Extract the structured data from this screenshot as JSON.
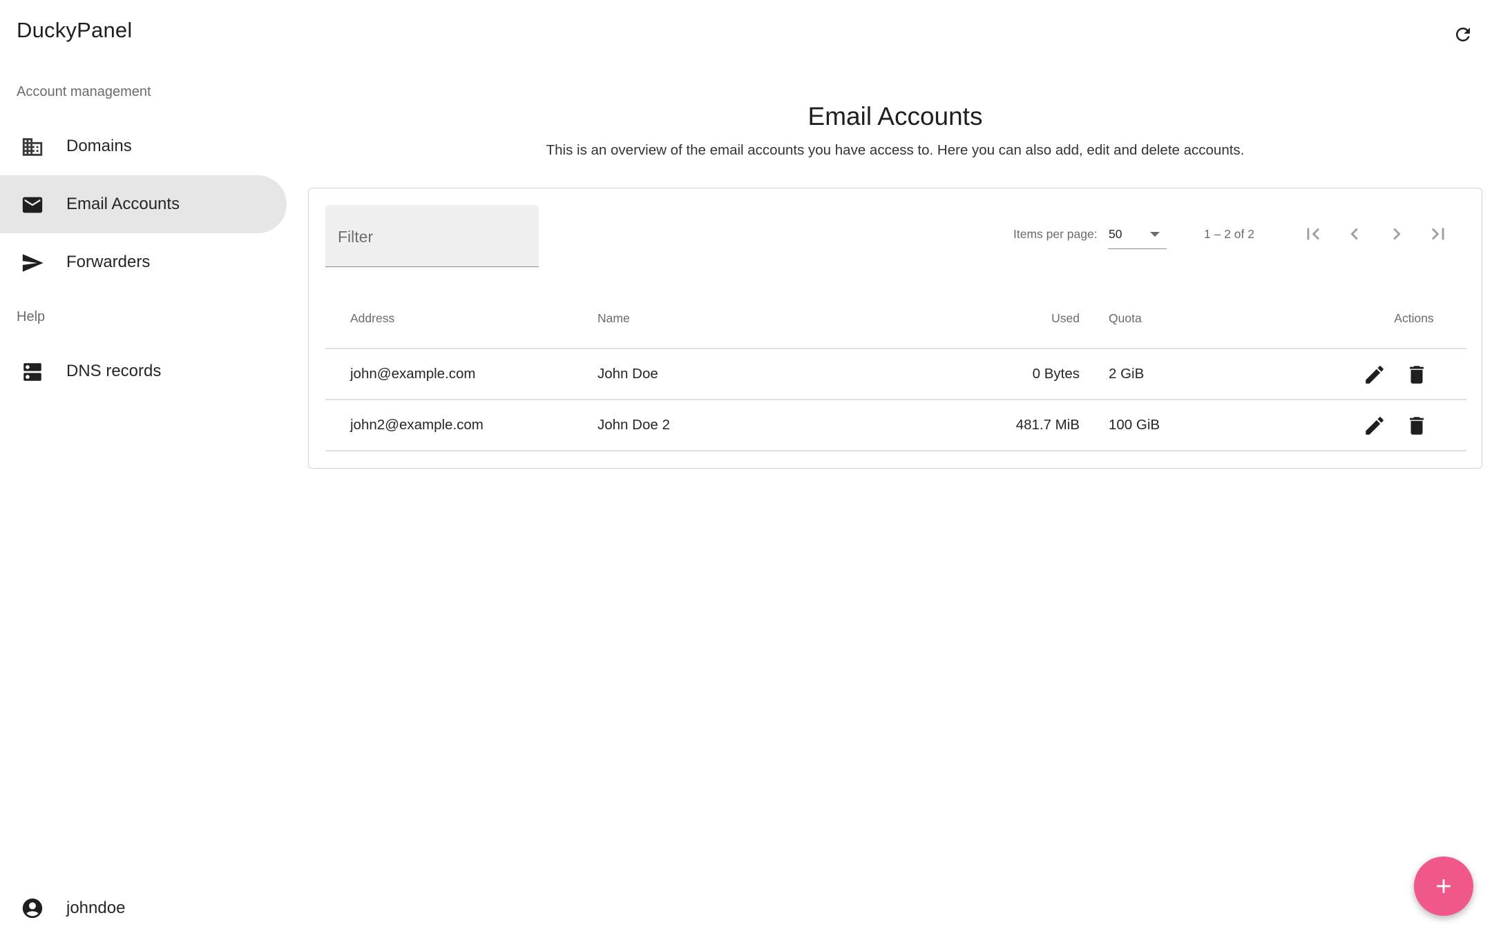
{
  "app": {
    "title": "DuckyPanel"
  },
  "sidebar": {
    "section_account": "Account management",
    "section_help": "Help",
    "items": [
      {
        "label": "Domains",
        "icon": "domain-icon",
        "active": false
      },
      {
        "label": "Email Accounts",
        "icon": "mail-icon",
        "active": true
      },
      {
        "label": "Forwarders",
        "icon": "send-icon",
        "active": false
      },
      {
        "label": "DNS records",
        "icon": "dns-icon",
        "active": false
      }
    ],
    "user": {
      "label": "johndoe",
      "icon": "account-circle-icon"
    }
  },
  "page": {
    "title": "Email Accounts",
    "subtitle": "This is an overview of the email accounts you have access to. Here you can also add, edit and delete accounts."
  },
  "filter": {
    "placeholder": "Filter"
  },
  "paginator": {
    "items_per_page_label": "Items per page:",
    "items_per_page_value": "50",
    "range": "1 – 2 of 2"
  },
  "table": {
    "headers": {
      "address": "Address",
      "name": "Name",
      "used": "Used",
      "quota": "Quota",
      "actions": "Actions"
    },
    "rows": [
      {
        "address": "john@example.com",
        "name": "John Doe",
        "used": "0 Bytes",
        "quota": "2 GiB"
      },
      {
        "address": "john2@example.com",
        "name": "John Doe 2",
        "used": "481.7 MiB",
        "quota": "100 GiB"
      }
    ]
  },
  "colors": {
    "accent": "#f0588a",
    "active_nav": "#e6e6e6"
  }
}
